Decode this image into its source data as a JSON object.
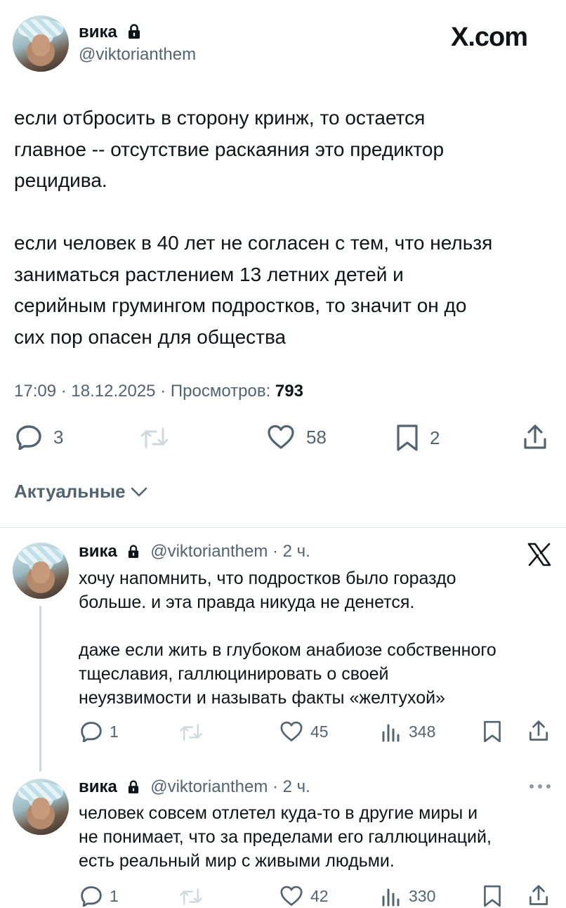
{
  "main_tweet": {
    "name": "вика",
    "handle": "@viktorianthem",
    "site": "X.com",
    "text": "если отбросить в сторону кринж, то остается\nглавное -- отсутствие раскаяния это предиктор\nрецидива.\n\nесли человек в 40 лет не согласен с тем, что нельзя\nзаниматься растлением 13 летних детей и\nсерийным грумингом подростков, то значит он до\nсих пор опасен для общества",
    "time": "17:09",
    "date": "18.12.2025",
    "views_label": "Просмотров:",
    "views": "793",
    "separator": "·",
    "replies": "3",
    "reposts": "",
    "likes": "58",
    "bookmarks": "2"
  },
  "sort_label": "Актуальные",
  "replies": [
    {
      "name": "вика",
      "handle": "@viktorianthem",
      "dot": "·",
      "time": "2 ч.",
      "text": "хочу напомнить, что подростков было гораздо\nбольше. и эта правда никуда не денется.\n\nдаже если жить в глубоком анабиозе собственного\nтщеславия, галлюцинировать о своей\nнеуязвимости и называть факты «желтухой»",
      "replies": "1",
      "likes": "45",
      "views": "348"
    },
    {
      "name": "вика",
      "handle": "@viktorianthem",
      "dot": "·",
      "time": "2 ч.",
      "text": "человек совсем отлетел куда-то в другие миры и\nне понимает, что за пределами его галлюцинаций,\nесть реальный мир с живыми людьми.",
      "replies": "1",
      "likes": "42",
      "views": "330"
    }
  ],
  "colors": {
    "text": "#0f1419",
    "secondary": "#536471",
    "divider": "#e1e6ea"
  },
  "icons": [
    "lock-icon",
    "x-logo-icon",
    "reply-icon",
    "repost-icon",
    "like-icon",
    "bookmark-icon",
    "share-icon",
    "views-icon",
    "chevron-down-icon",
    "more-icon"
  ]
}
